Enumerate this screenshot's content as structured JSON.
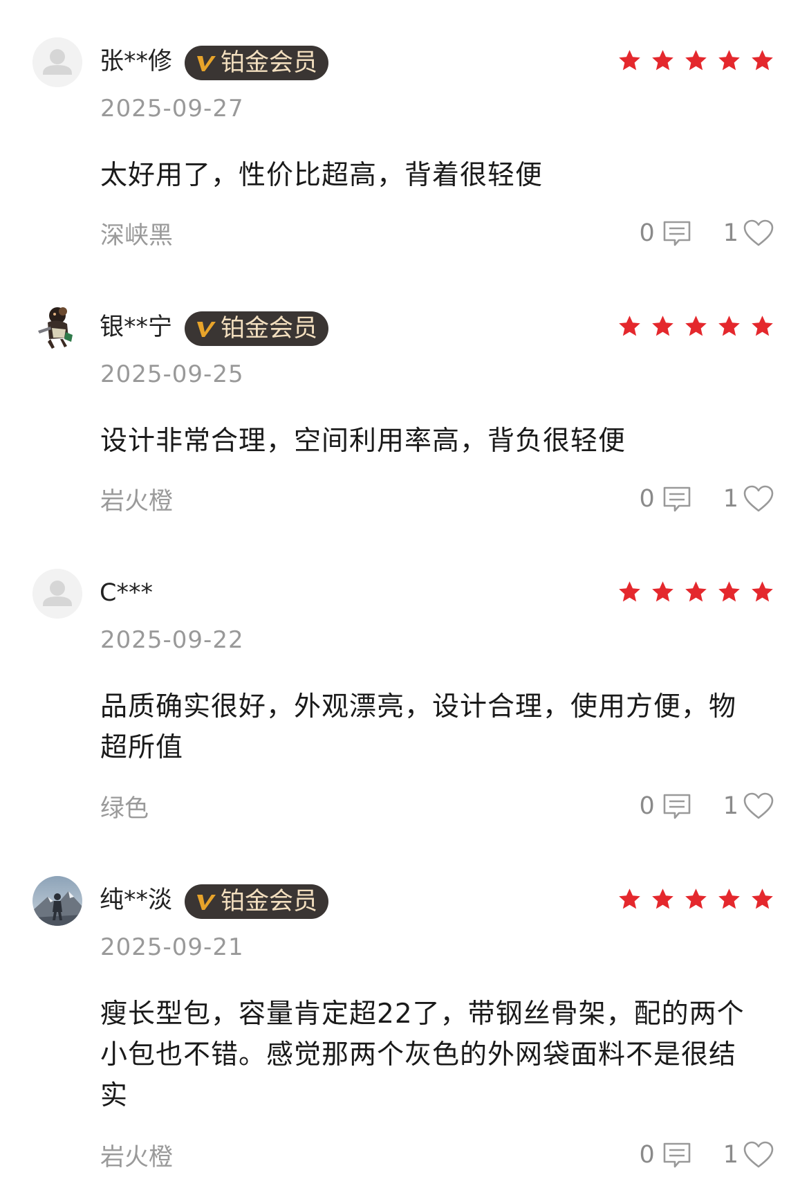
{
  "colors": {
    "star": "#e4282d",
    "badge_bg": "#3a3533",
    "badge_text": "#f3dfbf",
    "badge_v": "#e8a42a",
    "meta": "#999999"
  },
  "reviews": [
    {
      "username": "张**修",
      "badge": "铂金会员",
      "avatar": "default-avatar-icon",
      "rating": 5,
      "date": "2025-09-27",
      "content": "太好用了，性价比超高，背着很轻便",
      "variant": "深峡黑",
      "comment_count": "0",
      "like_count": "1"
    },
    {
      "username": "银**宁",
      "badge": "铂金会员",
      "avatar": "character-avatar",
      "rating": 5,
      "date": "2025-09-25",
      "content": "设计非常合理，空间利用率高，背负很轻便",
      "variant": "岩火橙",
      "comment_count": "0",
      "like_count": "1"
    },
    {
      "username": "C***",
      "avatar": "default-avatar-icon",
      "rating": 5,
      "date": "2025-09-22",
      "content": "品质确实很好，外观漂亮，设计合理，使用方便，物超所值",
      "variant": "绿色",
      "comment_count": "0",
      "like_count": "1"
    },
    {
      "username": "纯**淡",
      "badge": "铂金会员",
      "avatar": "mountain-photo-avatar",
      "rating": 5,
      "date": "2025-09-21",
      "content": "瘦长型包，容量肯定超22了，带钢丝骨架，配的两个小包也不错。感觉那两个灰色的外网袋面料不是很结实",
      "variant": "岩火橙",
      "comment_count": "0",
      "like_count": "1"
    }
  ]
}
